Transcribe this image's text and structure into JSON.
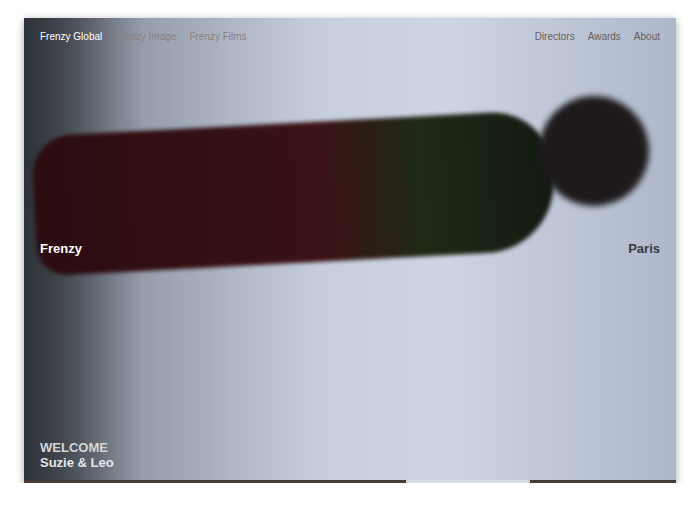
{
  "nav": {
    "left": [
      {
        "label": "Frenzy Global",
        "selected": true
      },
      {
        "label": "Frenzy Image",
        "selected": false
      },
      {
        "label": "Frenzy Films",
        "selected": false
      }
    ],
    "right": [
      {
        "label": "Directors"
      },
      {
        "label": "Awards"
      },
      {
        "label": "About"
      }
    ]
  },
  "hero": {
    "left_label": "Frenzy",
    "right_label": "Paris"
  },
  "caption": {
    "title": "WELCOME",
    "subtitle": "Suzie & Leo"
  },
  "slides": [
    {
      "selected": false
    },
    {
      "selected": true
    },
    {
      "selected": false
    }
  ]
}
